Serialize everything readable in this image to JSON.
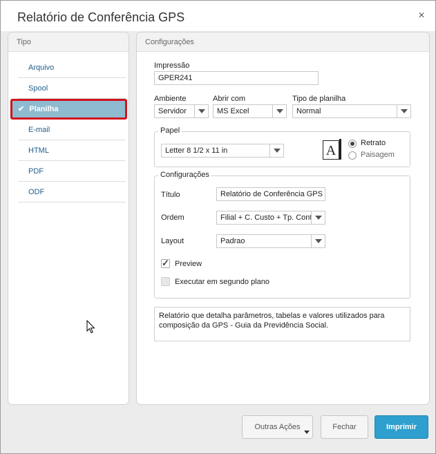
{
  "dialog": {
    "title": "Relatório de Conferência GPS",
    "close_glyph": "×"
  },
  "tipo": {
    "header": "Tipo",
    "items": [
      {
        "label": "Arquivo",
        "selected": false
      },
      {
        "label": "Spool",
        "selected": false
      },
      {
        "label": "Planilha",
        "selected": true
      },
      {
        "label": "E-mail",
        "selected": false
      },
      {
        "label": "HTML",
        "selected": false
      },
      {
        "label": "PDF",
        "selected": false
      },
      {
        "label": "ODF",
        "selected": false
      }
    ],
    "check_glyph": "✔"
  },
  "config": {
    "header": "Configurações",
    "impressao": {
      "label": "Impressão",
      "value": "GPER241"
    },
    "ambiente": {
      "label": "Ambiente",
      "value": "Servidor"
    },
    "abrir_com": {
      "label": "Abrir com",
      "value": "MS Excel"
    },
    "tipo_planilha": {
      "label": "Tipo de planilha",
      "value": "Normal"
    },
    "papel": {
      "legend": "Papel",
      "size": "Letter 8 1/2 x 11 in",
      "icon_letter": "A",
      "retrato": "Retrato",
      "paisagem": "Paisagem",
      "orientation": "Retrato"
    },
    "configuracoes": {
      "legend": "Configurações",
      "titulo_label": "Título",
      "titulo_value": "Relatório de Conferência GPS",
      "ordem_label": "Ordem",
      "ordem_value": "Filial + C. Custo + Tp. Contr.",
      "layout_label": "Layout",
      "layout_value": "Padrao",
      "preview_label": "Preview",
      "preview_checked": true,
      "segundo_plano_label": "Executar em segundo plano",
      "segundo_plano_checked": false
    },
    "description": "Relatório que detalha parâmetros, tabelas e valores utilizados para composição da GPS - Guia da Previdência Social."
  },
  "footer": {
    "outras_acoes": "Outras Ações",
    "fechar": "Fechar",
    "imprimir": "Imprimir"
  }
}
